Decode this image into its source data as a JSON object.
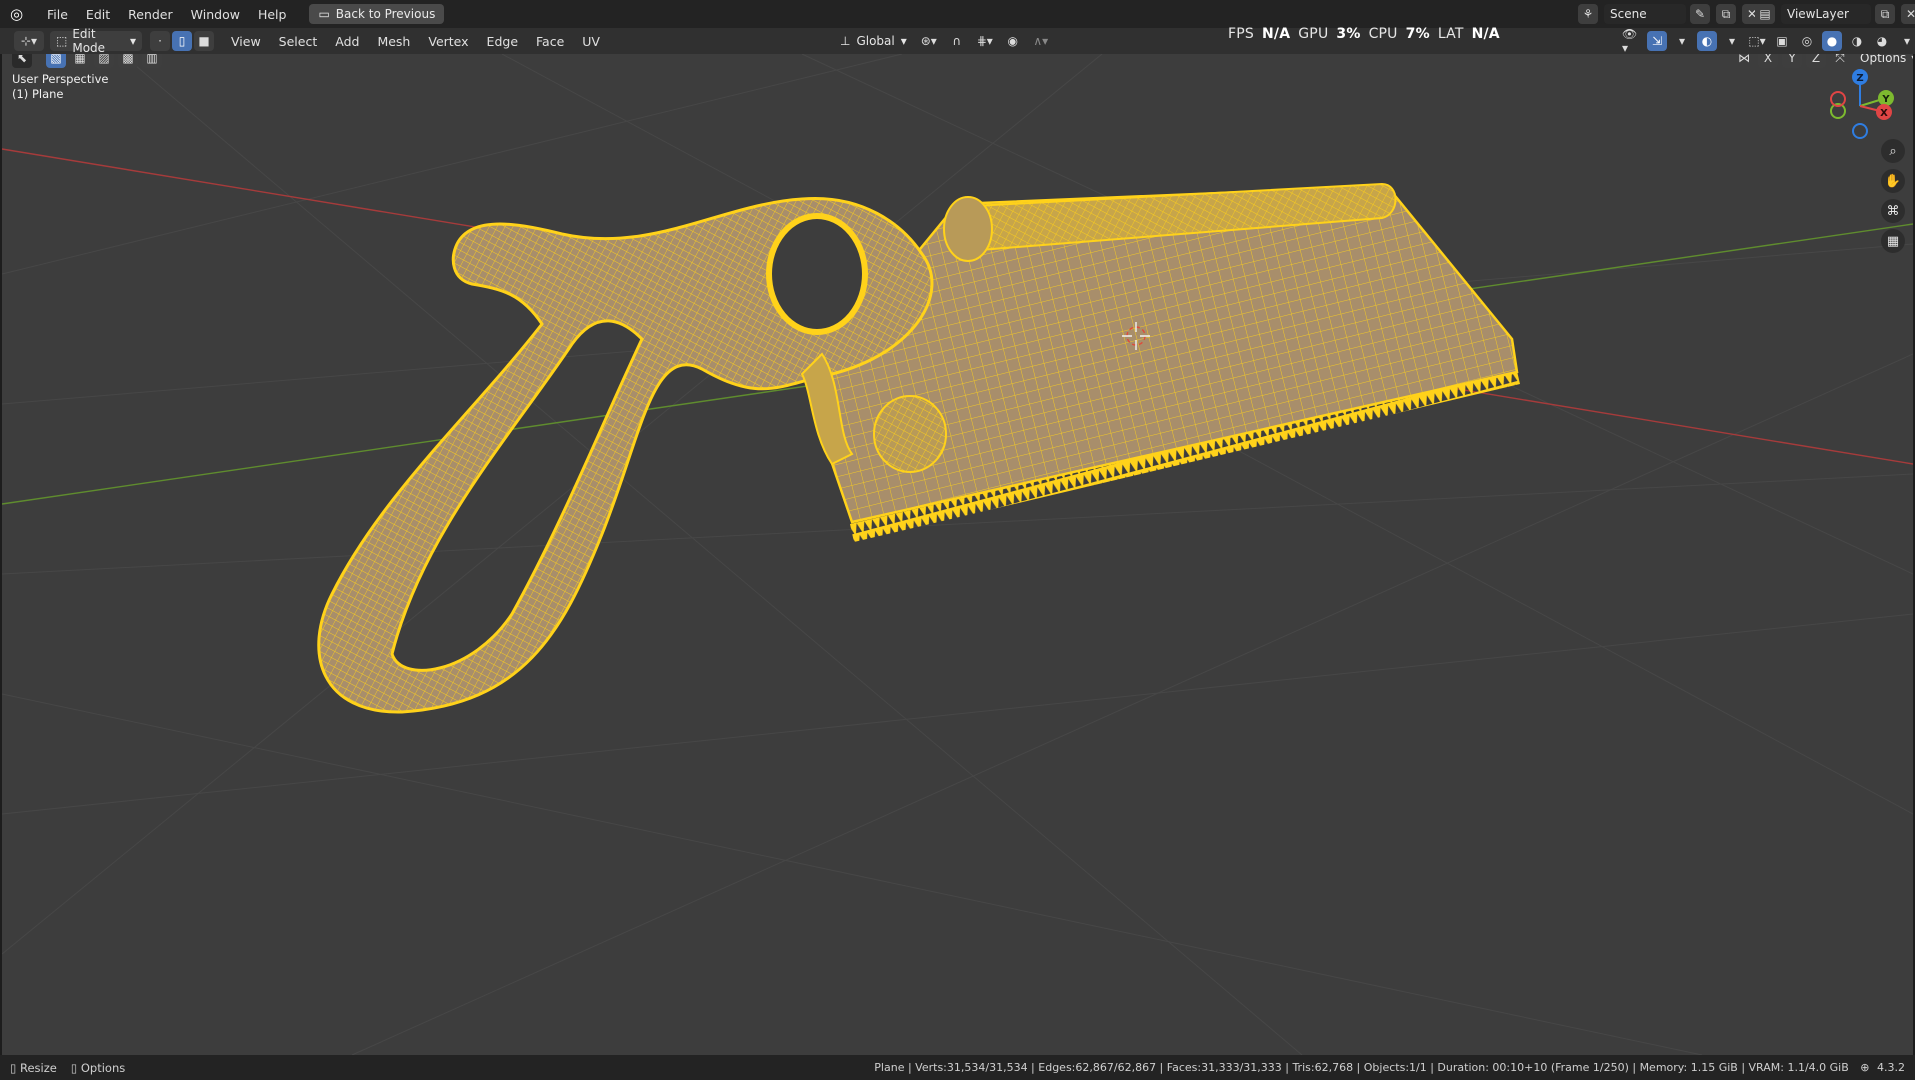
{
  "menu": {
    "file": "File",
    "edit": "Edit",
    "render": "Render",
    "window": "Window",
    "help": "Help",
    "back_button": "Back to Previous"
  },
  "scene": {
    "label": "Scene"
  },
  "viewlayer": {
    "label": "ViewLayer"
  },
  "header": {
    "mode": "Edit Mode",
    "view": "View",
    "select": "Select",
    "add": "Add",
    "mesh": "Mesh",
    "vertex": "Vertex",
    "edge": "Edge",
    "face": "Face",
    "uv": "UV",
    "transform_orientation": "Global",
    "options": "Options",
    "axis_x": "X",
    "axis_y": "Y",
    "axis_z": "Z"
  },
  "perf": {
    "fps_label": "FPS",
    "fps_value": "N/A",
    "gpu_label": "GPU",
    "gpu_value": "3%",
    "cpu_label": "CPU",
    "cpu_value": "7%",
    "lat_label": "LAT",
    "lat_value": "N/A"
  },
  "viewport": {
    "perspective": "User Perspective",
    "object": "(1) Plane",
    "accent_color": "#ffd21a",
    "grid_x_color": "#a63b3b",
    "grid_y_color": "#5f8c2e"
  },
  "gizmo": {
    "x": "X",
    "y": "Y",
    "z": "Z"
  },
  "status": {
    "resize": "Resize",
    "options": "Options",
    "info": "Plane | Verts:31,534/31,534 | Edges:62,867/62,867 | Faces:31,333/31,333 | Tris:62,768 | Objects:1/1 | Duration: 00:10+10 (Frame 1/250) | Memory: 1.15 GiB | VRAM: 1.1/4.0 GiB",
    "version": "4.3.2"
  }
}
